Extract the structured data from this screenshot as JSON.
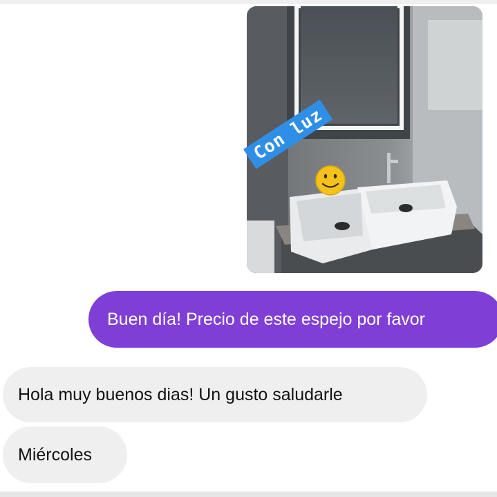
{
  "chat": {
    "image_message": {
      "sticker_text": "Con luz",
      "sticker_color": "#2f8fe6",
      "emoji_icon": "smiling-face-icon"
    },
    "outgoing_message": "Buen día! Precio de este espejo por favor",
    "incoming_messages": [
      "Hola muy buenos dias! Un gusto saludarle",
      "Miércoles"
    ],
    "colors": {
      "outgoing_bubble": "#7f3fd6",
      "incoming_bubble": "#efefef"
    }
  }
}
